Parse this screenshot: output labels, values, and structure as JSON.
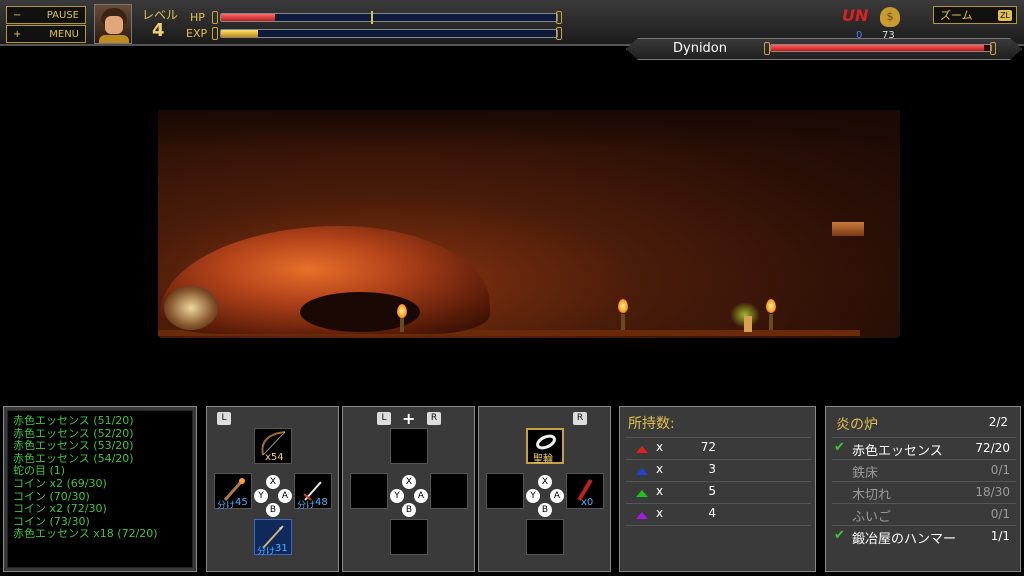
{
  "hud": {
    "pause_sign": "−",
    "pause_label": "PAUSE",
    "menu_sign": "+",
    "menu_label": "MENU",
    "level_label": "レベル",
    "level_value": "4",
    "hp_label": "HP",
    "exp_label": "EXP",
    "hp_fraction": 0.16,
    "exp_fraction": 0.11,
    "un_label": "UN",
    "un_count": "0",
    "coin_count": "73",
    "zoom_label": "ズーム",
    "zoom_badge": "ZL"
  },
  "boss": {
    "name": "Dynidon",
    "hp_fraction": 0.97
  },
  "log": [
    "赤色エッセンス (51/20)",
    "赤色エッセンス (52/20)",
    "赤色エッセンス (53/20)",
    "赤色エッセンス (54/20)",
    "蛇の目 (1)",
    "コイン x2 (69/30)",
    "コイン (70/30)",
    "コイン x2 (72/30)",
    "コイン (73/30)",
    "赤色エッセンス x18 (72/20)"
  ],
  "pads": {
    "pad1": {
      "shoulder": "L",
      "top_count": "x54",
      "left_count": "45",
      "right_count": "48",
      "bottom_count": "31",
      "buttons": [
        "X",
        "Y",
        "A",
        "B"
      ]
    },
    "pad2": {
      "shoulder_left": "L",
      "plus": "+",
      "shoulder_right": "R",
      "buttons": [
        "X",
        "Y",
        "A",
        "B"
      ]
    },
    "pad3": {
      "shoulder": "R",
      "top_name": "聖輪",
      "right_count": "x0",
      "buttons": [
        "X",
        "Y",
        "A",
        "B"
      ]
    }
  },
  "stock": {
    "title": "所持数:",
    "rows": [
      {
        "color": "#e02020",
        "x": "x",
        "count": "72"
      },
      {
        "color": "#2040e0",
        "x": "x",
        "count": "3"
      },
      {
        "color": "#20c020",
        "x": "x",
        "count": "5"
      },
      {
        "color": "#a020e0",
        "x": "x",
        "count": "4"
      }
    ]
  },
  "quest": {
    "title": "炎の炉",
    "progress": "2/2",
    "check": "✔",
    "items": [
      {
        "name": "赤色エッセンス",
        "count": "72/20",
        "done": true
      },
      {
        "name": "鉄床",
        "count": "0/1",
        "done": false
      },
      {
        "name": "木切れ",
        "count": "18/30",
        "done": false
      },
      {
        "name": "ふいご",
        "count": "0/1",
        "done": false
      },
      {
        "name": "鍛冶屋のハンマー",
        "count": "1/1",
        "done": true
      }
    ]
  }
}
